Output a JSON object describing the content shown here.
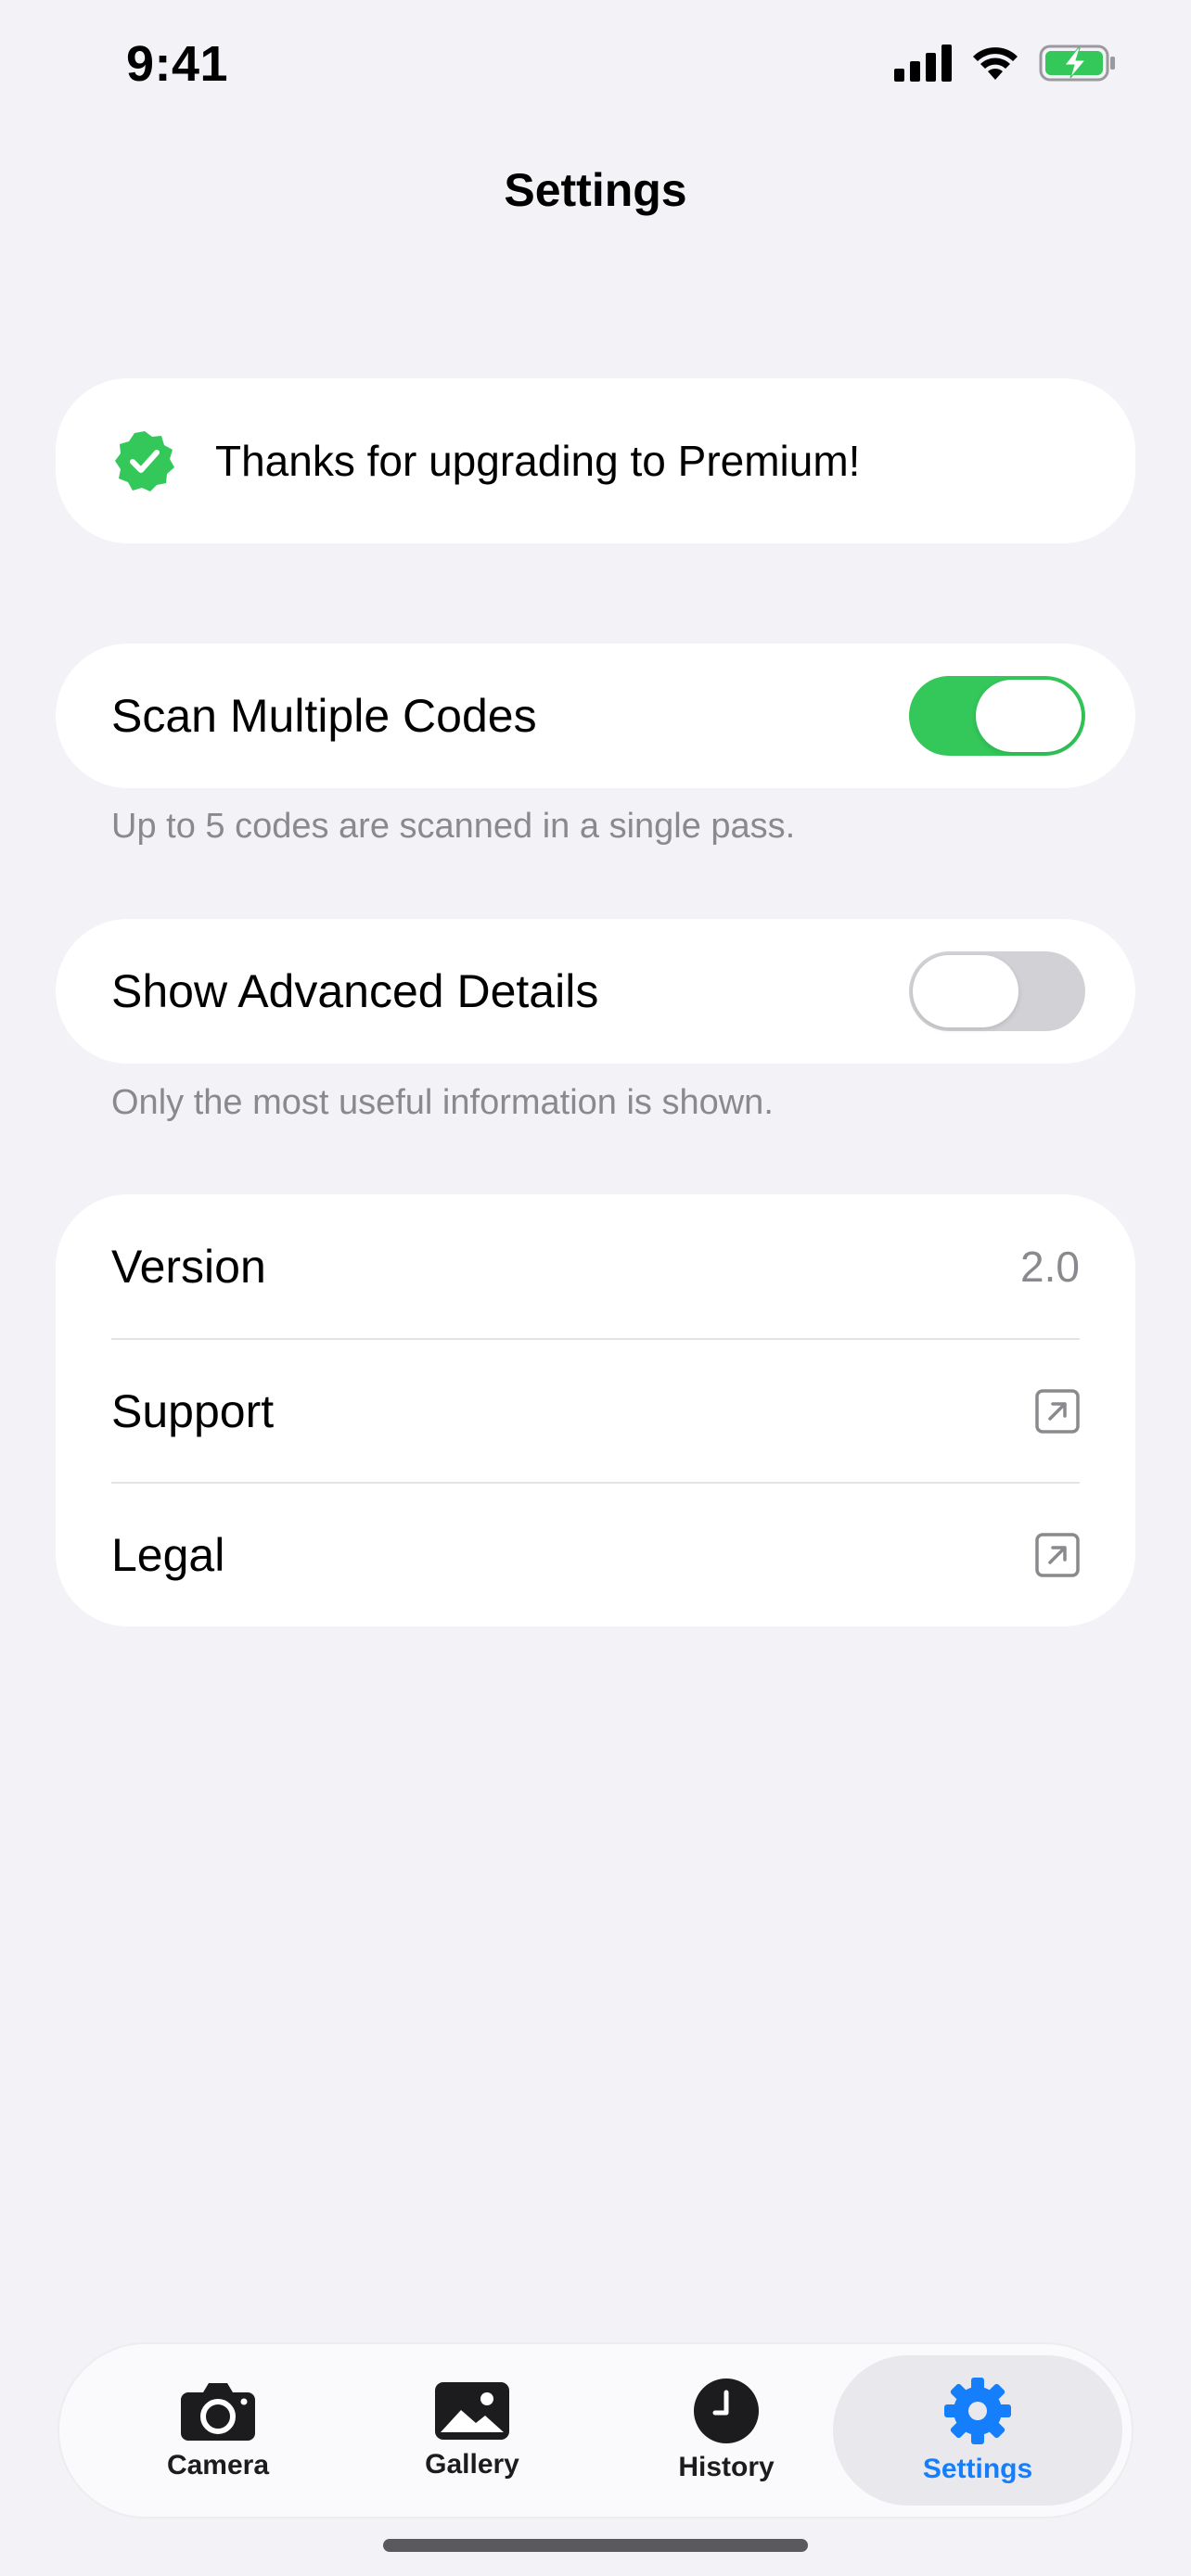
{
  "status_bar": {
    "time": "9:41",
    "icons": [
      "cellular-signal-icon",
      "wifi-icon",
      "battery-charging-icon"
    ]
  },
  "nav": {
    "title": "Settings"
  },
  "premium": {
    "icon": "verified-badge-icon",
    "text": "Thanks for upgrading to Premium!"
  },
  "settings": {
    "scan_multiple": {
      "label": "Scan Multiple Codes",
      "on": true,
      "footnote": "Up to 5 codes are scanned in a single pass."
    },
    "advanced_details": {
      "label": "Show Advanced Details",
      "on": false,
      "footnote": "Only the most useful information is shown."
    }
  },
  "info": {
    "rows": [
      {
        "label": "Version",
        "value": "2.0"
      },
      {
        "label": "Support",
        "icon": "external-link-icon"
      },
      {
        "label": "Legal",
        "icon": "external-link-icon"
      }
    ]
  },
  "tab_bar": {
    "tabs": [
      {
        "label": "Camera",
        "icon": "camera-icon"
      },
      {
        "label": "Gallery",
        "icon": "photo-icon"
      },
      {
        "label": "History",
        "icon": "clock-icon"
      },
      {
        "label": "Settings",
        "icon": "gear-icon",
        "active": true
      }
    ]
  },
  "colors": {
    "background": "#F2F2F7",
    "card": "#FFFFFF",
    "accent_blue": "#147EFB",
    "toggle_on": "#34C759",
    "toggle_off": "#D1D1D6",
    "secondary_text": "#8A8A8E"
  }
}
